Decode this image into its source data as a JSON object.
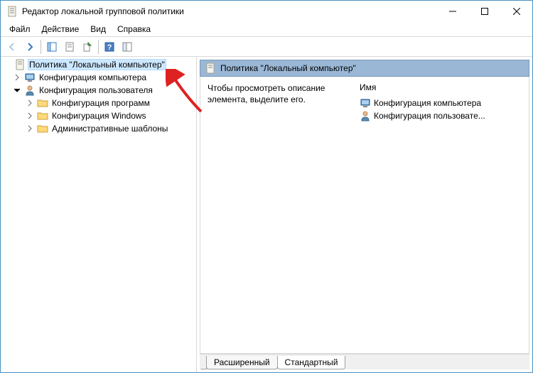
{
  "window": {
    "title": "Редактор локальной групповой политики"
  },
  "menu": {
    "file": "Файл",
    "action": "Действие",
    "view": "Вид",
    "help": "Справка"
  },
  "tree": {
    "root": "Политика \"Локальный компьютер\"",
    "computer_config": "Конфигурация компьютера",
    "user_config": "Конфигурация пользователя",
    "software_settings": "Конфигурация программ",
    "windows_settings": "Конфигурация Windows",
    "admin_templates": "Административные шаблоны"
  },
  "content": {
    "header_title": "Политика \"Локальный компьютер\"",
    "description_hint": "Чтобы просмотреть описание элемента, выделите его.",
    "column_name": "Имя",
    "items": {
      "computer": "Конфигурация компьютера",
      "user": "Конфигурация пользовате..."
    }
  },
  "tabs": {
    "extended": "Расширенный",
    "standard": "Стандартный"
  }
}
